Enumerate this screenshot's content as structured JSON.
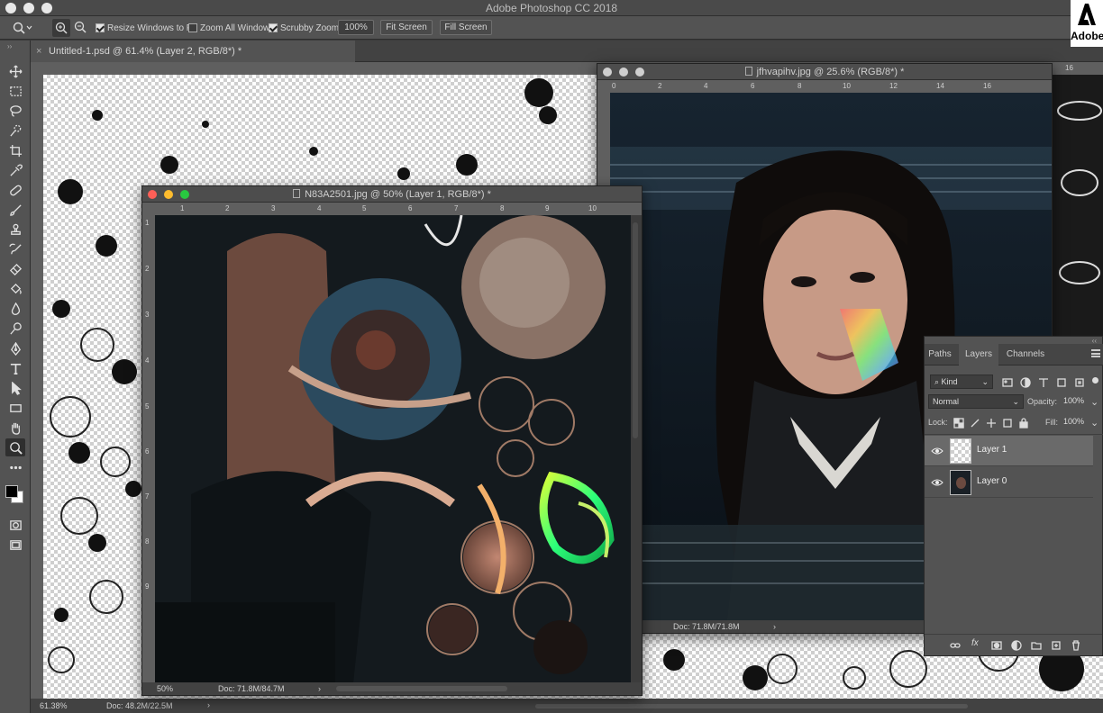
{
  "app": {
    "title": "Adobe Photoshop CC 2018",
    "brand": "Adobe"
  },
  "options_bar": {
    "resize_windows": "Resize Windows to Fit",
    "zoom_all": "Zoom All Windows",
    "scrubby": "Scrubby Zoom",
    "zoom_value": "100%",
    "fit_screen": "Fit Screen",
    "fill_screen": "Fill Screen",
    "resize_checked": true,
    "zoom_all_checked": false,
    "scrubby_checked": true
  },
  "tab": {
    "label": "Untitled-1.psd @ 61.4% (Layer 2, RGB/8*) *"
  },
  "main_status": {
    "zoom": "61.38%",
    "doc": "Doc: 48.2M/22.5M",
    "arrow": "›"
  },
  "window_front": {
    "title": "N83A2501.jpg @ 50% (Layer 1, RGB/8*) *",
    "zoom": "50%",
    "doc": "Doc: 71.8M/84.7M",
    "arrow": "›",
    "ruler_h": [
      "1",
      "2",
      "3",
      "4",
      "5",
      "6",
      "7",
      "8",
      "9",
      "10"
    ],
    "ruler_v": [
      "1",
      "2",
      "3",
      "4",
      "5",
      "6",
      "7",
      "8",
      "9"
    ]
  },
  "window_back": {
    "title": "jfhvapihv.jpg @ 25.6% (RGB/8*) *",
    "doc": "Doc: 71.8M/71.8M",
    "arrow": "›",
    "ruler_h": [
      "0",
      "2",
      "4",
      "6",
      "8",
      "10",
      "12",
      "14",
      "16"
    ]
  },
  "main_ruler": {
    "edge_label": "16"
  },
  "layers_panel": {
    "tabs": [
      "Paths",
      "Layers",
      "Channels"
    ],
    "active_tab": "Layers",
    "filter": "Kind",
    "blend_mode": "Normal",
    "opacity_label": "Opacity:",
    "opacity": "100%",
    "lock_label": "Lock:",
    "fill_label": "Fill:",
    "fill": "100%",
    "layers": [
      {
        "name": "Layer 1",
        "selected": true
      },
      {
        "name": "Layer 0",
        "selected": false
      }
    ]
  },
  "colors": {
    "accent": "#535353",
    "selected_row": "#6a6a6a",
    "close": "#fe5f57",
    "min": "#febc2e",
    "max": "#28c840"
  }
}
